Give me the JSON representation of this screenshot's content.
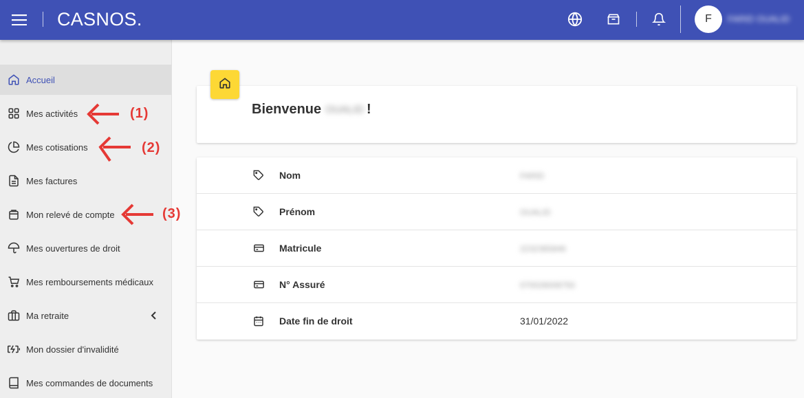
{
  "header": {
    "brand": "CASNOS.",
    "avatar_initial": "F",
    "user_name": "FARID OUALID"
  },
  "sidebar": {
    "items": [
      {
        "label": "Accueil",
        "icon": "home-icon",
        "active": true
      },
      {
        "label": "Mes activités",
        "icon": "grid-icon"
      },
      {
        "label": "Mes cotisations",
        "icon": "pie-chart-icon"
      },
      {
        "label": "Mes factures",
        "icon": "document-icon"
      },
      {
        "label": "Mon relevé de compte",
        "icon": "package-icon"
      },
      {
        "label": "Mes ouvertures de droit",
        "icon": "umbrella-icon"
      },
      {
        "label": "Mes remboursements médicaux",
        "icon": "cart-icon"
      },
      {
        "label": "Ma retraite",
        "icon": "briefcase-icon",
        "expandable": true
      },
      {
        "label": "Mon dossier d'invalidité",
        "icon": "battery-charging-icon"
      },
      {
        "label": "Mes commandes de documents",
        "icon": "book-icon"
      }
    ]
  },
  "annotations": [
    "(1)",
    "(2)",
    "(3)"
  ],
  "welcome": {
    "prefix": "Bienvenue",
    "name": "OUALID",
    "suffix": "!"
  },
  "info": {
    "rows": [
      {
        "label": "Nom",
        "value": "FARID",
        "blurred": true,
        "icon": "tag-icon"
      },
      {
        "label": "Prénom",
        "value": "OUALID",
        "blurred": true,
        "icon": "tag-icon"
      },
      {
        "label": "Matricule",
        "value": "2232365846",
        "blurred": true,
        "icon": "credit-card-icon"
      },
      {
        "label": "N° Assuré",
        "value": "070026008750",
        "blurred": true,
        "icon": "credit-card-icon"
      },
      {
        "label": "Date fin de droit",
        "value": "31/01/2022",
        "blurred": false,
        "icon": "calendar-icon"
      }
    ]
  },
  "colors": {
    "primary": "#3f51b5",
    "accent": "#fdd835",
    "annotation": "#e53935"
  }
}
